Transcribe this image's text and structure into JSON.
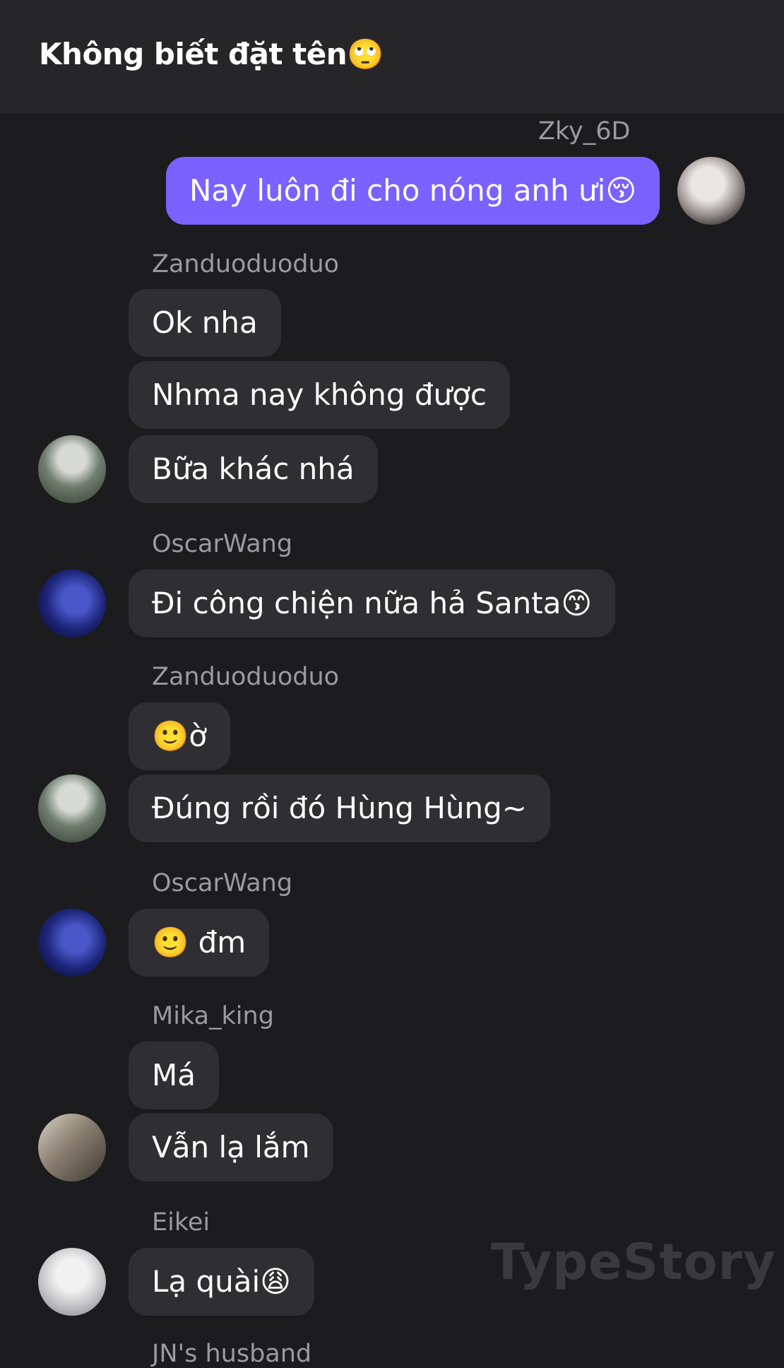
{
  "header": {
    "title": "Không biết đặt tên🙄"
  },
  "messages": [
    {
      "sender": "Zky_6D",
      "avatar_icon": "zky-avatar",
      "texts": [
        "Nay luôn đi cho nóng anh ưi😚"
      ],
      "mine": true
    },
    {
      "sender": "Zanduoduoduo",
      "avatar_icon": "zanduoduoduo-avatar",
      "texts": [
        "Ok nha",
        "Nhma nay không được",
        "Bữa khác nhá"
      ]
    },
    {
      "sender": "OscarWang",
      "avatar_icon": "oscarwang-avatar",
      "texts": [
        "Đi công chiện nữa hả Santa😙"
      ]
    },
    {
      "sender": "Zanduoduoduo",
      "avatar_icon": "zanduoduoduo-avatar",
      "texts": [
        "🙂ờ",
        "Đúng rồi đó Hùng Hùng~"
      ]
    },
    {
      "sender": "OscarWang",
      "avatar_icon": "oscarwang-avatar",
      "texts": [
        "🙂 đm"
      ]
    },
    {
      "sender": "Mika_king",
      "avatar_icon": "mika-king-avatar",
      "texts": [
        "Má",
        "Vẫn lạ lắm"
      ]
    },
    {
      "sender": "Eikei",
      "avatar_icon": "eikei-avatar",
      "texts": [
        "Lạ quài😩"
      ]
    },
    {
      "sender": "JN's husband"
    }
  ],
  "watermark": "TypeStory",
  "colors": {
    "background": "#1c1c1e",
    "header": "#262628",
    "bubble": "#2f2f33",
    "my_bubble": "#7b61ff",
    "sender_name": "#9a9aa0"
  }
}
